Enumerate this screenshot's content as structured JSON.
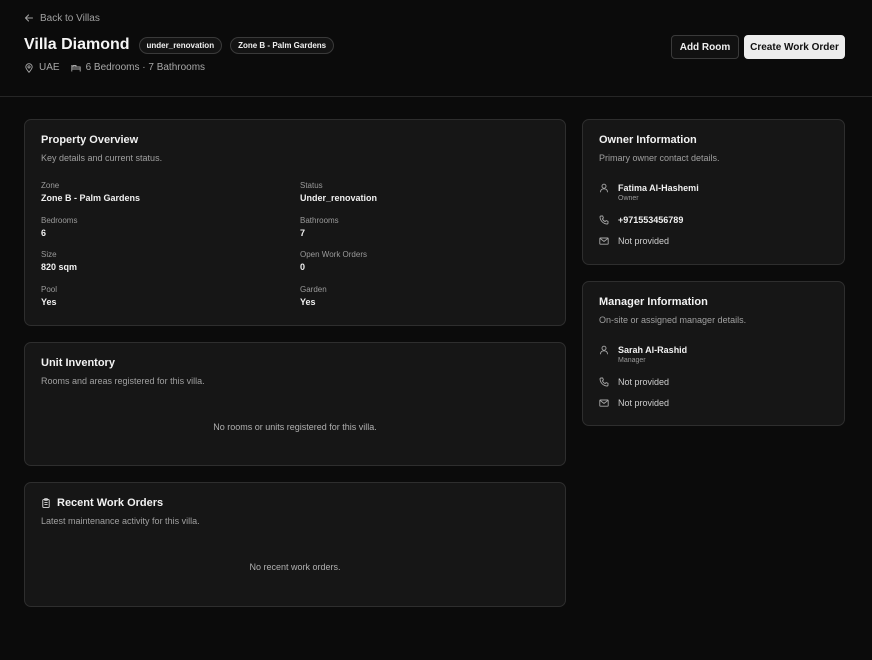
{
  "header": {
    "back_label": "Back to Villas",
    "title": "Villa Diamond",
    "badges": [
      "under_renovation",
      "Zone B - Palm Gardens"
    ],
    "location": "UAE",
    "rooms_summary": "6 Bedrooms · 7 Bathrooms",
    "add_room_label": "Add Room",
    "create_work_order_label": "Create Work Order"
  },
  "overview": {
    "title": "Property Overview",
    "subtitle": "Key details and current status.",
    "fields": [
      {
        "label": "Zone",
        "value": "Zone B - Palm Gardens"
      },
      {
        "label": "Status",
        "value": "Under_renovation"
      },
      {
        "label": "Bedrooms",
        "value": "6"
      },
      {
        "label": "Bathrooms",
        "value": "7"
      },
      {
        "label": "Size",
        "value": "820 sqm"
      },
      {
        "label": "Open Work Orders",
        "value": "0"
      },
      {
        "label": "Pool",
        "value": "Yes"
      },
      {
        "label": "Garden",
        "value": "Yes"
      }
    ]
  },
  "inventory": {
    "title": "Unit Inventory",
    "subtitle": "Rooms and areas registered for this villa.",
    "empty": "No rooms or units registered for this villa."
  },
  "work_orders": {
    "title": "Recent Work Orders",
    "subtitle": "Latest maintenance activity for this villa.",
    "empty": "No recent work orders.",
    "icon": "clipboard-icon"
  },
  "owner": {
    "title": "Owner Information",
    "subtitle": "Primary owner contact details.",
    "name": "Fatima Al-Hashemi",
    "role": "Owner",
    "phone": "+971553456789",
    "email": "Not provided"
  },
  "manager": {
    "title": "Manager Information",
    "subtitle": "On-site or assigned manager details.",
    "name": "Sarah Al-Rashid",
    "role": "Manager",
    "phone": "Not provided",
    "email": "Not provided"
  }
}
